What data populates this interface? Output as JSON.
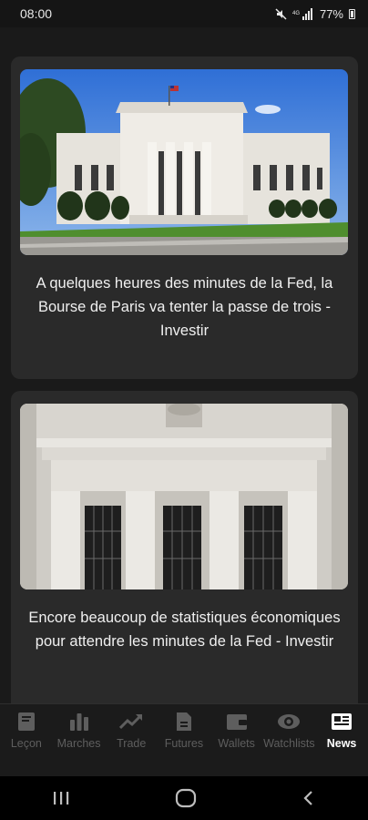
{
  "status_bar": {
    "time": "08:00",
    "battery_percent": "77%",
    "icons": [
      "mute-icon",
      "signal-icon",
      "battery-icon"
    ]
  },
  "articles": [
    {
      "title": "A quelques heures des minutes de la Fed, la Bourse de Paris va tenter la passe de trois - Investir",
      "image": "federal-reserve-building-photo"
    },
    {
      "title": "Encore beaucoup de statistiques économiques pour attendre les minutes de la Fed - Investir",
      "image": "federal-reserve-facade-photo"
    }
  ],
  "bottom_nav": {
    "items": [
      {
        "label": "Leçon",
        "icon": "book-icon"
      },
      {
        "label": "Marches",
        "icon": "bar-chart-icon"
      },
      {
        "label": "Trade",
        "icon": "trend-up-icon"
      },
      {
        "label": "Futures",
        "icon": "document-icon"
      },
      {
        "label": "Wallets",
        "icon": "wallet-icon"
      },
      {
        "label": "Watchlists",
        "icon": "eye-icon"
      },
      {
        "label": "News",
        "icon": "newspaper-icon"
      }
    ],
    "active": "News"
  },
  "system_nav": [
    "recent-apps-icon",
    "home-icon",
    "back-icon"
  ],
  "colors": {
    "background": "#1a1a1a",
    "card": "#2a2a2a",
    "nav_inactive": "#5e5e5e",
    "nav_active": "#ffffff"
  }
}
